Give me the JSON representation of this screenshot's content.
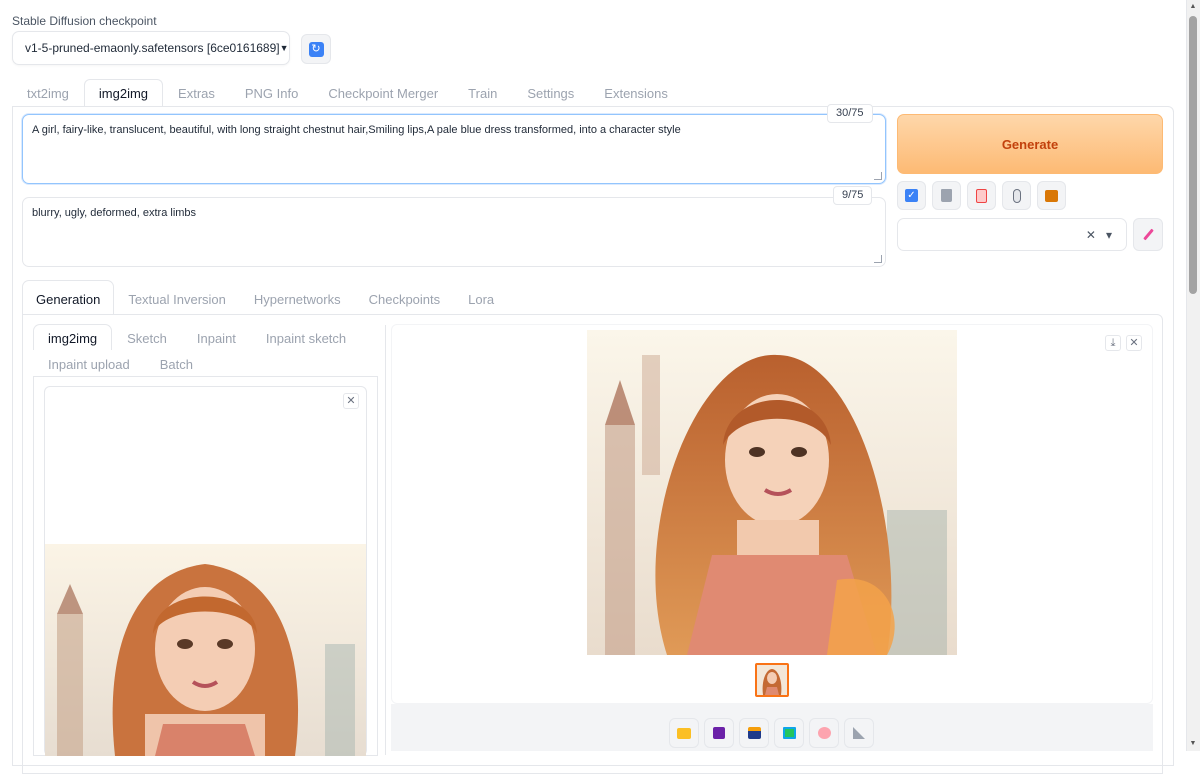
{
  "checkpoint": {
    "label": "Stable Diffusion checkpoint",
    "value": "v1-5-pruned-emaonly.safetensors [6ce0161689]"
  },
  "main_tabs": [
    "txt2img",
    "img2img",
    "Extras",
    "PNG Info",
    "Checkpoint Merger",
    "Train",
    "Settings",
    "Extensions"
  ],
  "prompt": {
    "text": "A girl, fairy-like, translucent, beautiful, with long straight chestnut hair,Smiling lips,A pale blue dress transformed, into a character style",
    "counter": "30/75"
  },
  "negative_prompt": {
    "text": "blurry, ugly, deformed, extra limbs",
    "counter": "9/75"
  },
  "generate_label": "Generate",
  "tools": [
    "check-icon",
    "trash-icon",
    "clipboard-icon",
    "hand-icon",
    "box-icon"
  ],
  "style_select": {
    "clear": "✕",
    "caret": "▾"
  },
  "sub_tabs": [
    "Generation",
    "Textual Inversion",
    "Hypernetworks",
    "Checkpoints",
    "Lora"
  ],
  "mode_tabs": [
    "img2img",
    "Sketch",
    "Inpaint",
    "Inpaint sketch",
    "Inpaint upload",
    "Batch"
  ],
  "output_actions": [
    "folder-icon",
    "save-icon",
    "zip-icon",
    "image-icon",
    "palette-icon",
    "ruler-icon"
  ]
}
